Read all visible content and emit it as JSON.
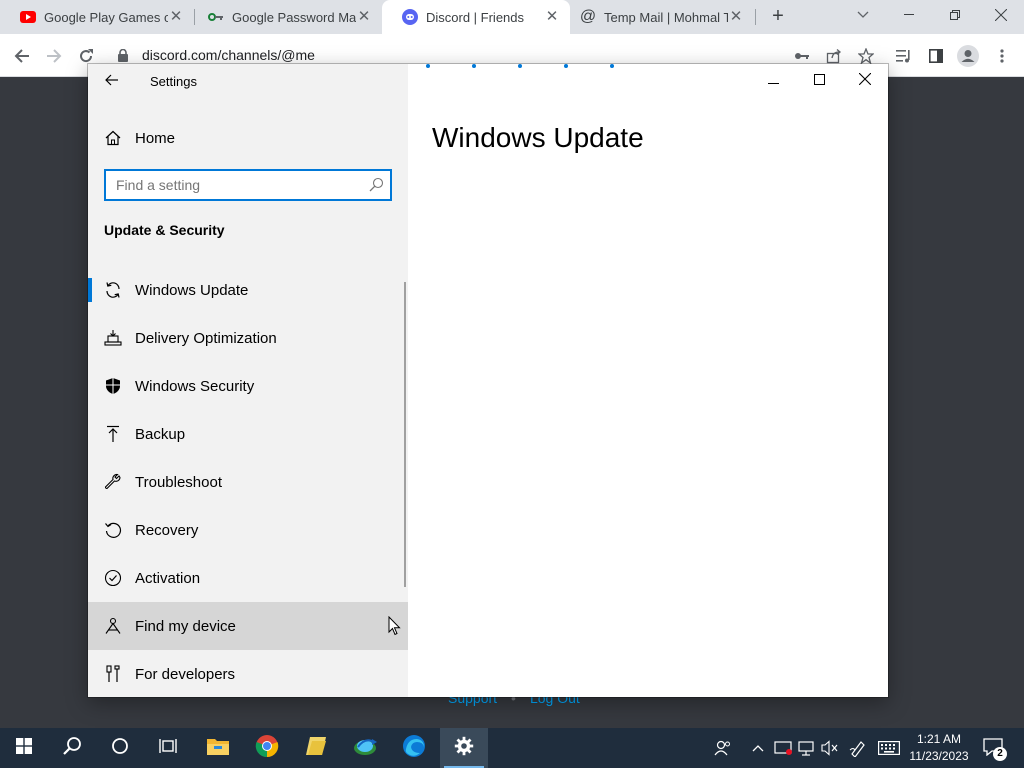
{
  "browser": {
    "tabs": [
      {
        "title": "Google Play Games or",
        "icon": "youtube-icon"
      },
      {
        "title": "Google Password Mar",
        "icon": "password-key-icon"
      },
      {
        "title": "Discord | Friends",
        "icon": "discord-icon",
        "active": true
      },
      {
        "title": "Temp Mail | Mohmal T",
        "icon": "at-sign-icon"
      }
    ],
    "url": "discord.com/channels/@me"
  },
  "page": {
    "footer_links": [
      "Support",
      "Log Out"
    ],
    "footer_separator": "•"
  },
  "settings": {
    "app_title": "Settings",
    "home_label": "Home",
    "search_placeholder": "Find a setting",
    "section_heading": "Update & Security",
    "nav_items": [
      {
        "label": "Windows Update",
        "icon": "sync-icon",
        "selected": true
      },
      {
        "label": "Delivery Optimization",
        "icon": "delivery-optimization-icon"
      },
      {
        "label": "Windows Security",
        "icon": "shield-icon"
      },
      {
        "label": "Backup",
        "icon": "backup-arrow-icon"
      },
      {
        "label": "Troubleshoot",
        "icon": "wrench-icon"
      },
      {
        "label": "Recovery",
        "icon": "recovery-icon"
      },
      {
        "label": "Activation",
        "icon": "check-circle-icon"
      },
      {
        "label": "Find my device",
        "icon": "find-device-icon",
        "hover": true
      },
      {
        "label": "For developers",
        "icon": "developer-tools-icon"
      }
    ],
    "page_title": "Windows Update",
    "accent_color": "#0078d7"
  },
  "taskbar": {
    "apps": [
      "start-icon",
      "search-icon",
      "cortana-icon",
      "task-view-icon",
      "file-explorer-icon",
      "chrome-icon",
      "folder-app-icon",
      "globe-app-icon",
      "edge-icon",
      "settings-gear-icon"
    ],
    "clock_time": "1:21 AM",
    "clock_date": "11/23/2023",
    "notification_count": "2"
  }
}
